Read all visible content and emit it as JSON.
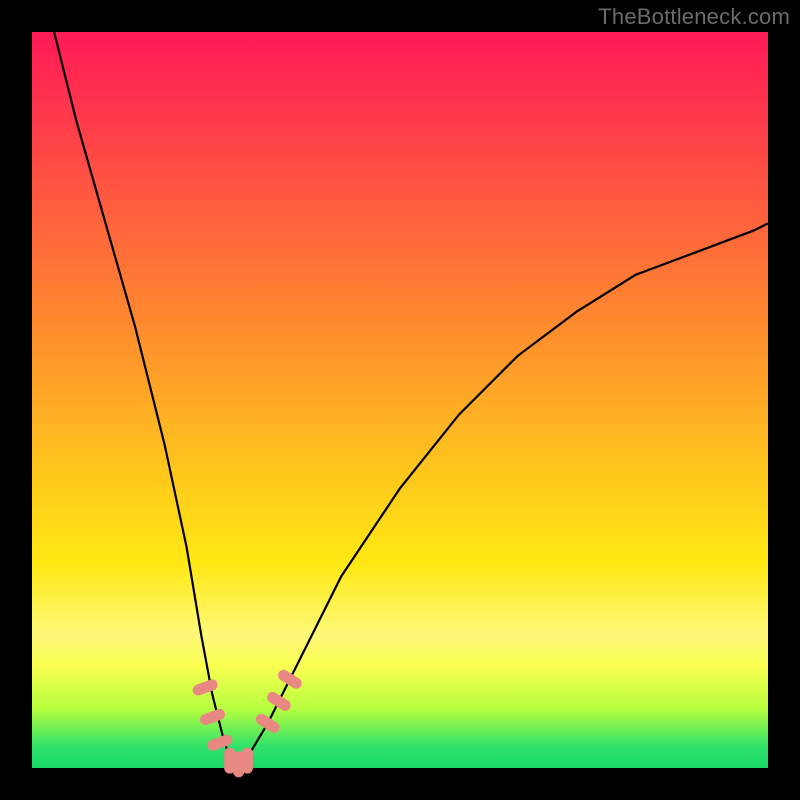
{
  "watermark": {
    "text": "TheBottleneck.com"
  },
  "colors": {
    "black": "#000000",
    "curve": "#000000",
    "marker": "#e98782",
    "gradient_top": "#ff1a55",
    "gradient_bottom": "#19d867"
  },
  "chart_data": {
    "type": "line",
    "title": "",
    "xlabel": "",
    "ylabel": "",
    "xlim": [
      0,
      100
    ],
    "ylim": [
      0,
      100
    ],
    "grid": false,
    "legend": false,
    "note": "V-shaped bottleneck curve. Background gradient encodes bottleneck severity: red (top) ≈ 100% mismatch, green (bottom) ≈ 0% mismatch. No axis ticks or numeric labels are rendered; values are approximate, read from pixel position relative to the plot area.",
    "series": [
      {
        "name": "bottleneck-curve",
        "x": [
          3,
          6,
          10,
          14,
          18,
          21,
          23,
          24.5,
          26,
          27,
          28,
          29,
          32,
          36,
          42,
          50,
          58,
          66,
          74,
          82,
          90,
          98,
          100
        ],
        "y": [
          100,
          88,
          74,
          60,
          44,
          30,
          18,
          10,
          4,
          1,
          0,
          1,
          6,
          14,
          26,
          38,
          48,
          56,
          62,
          67,
          70,
          73,
          74
        ]
      }
    ],
    "markers": [
      {
        "name": "left-band-1",
        "x": 23.5,
        "y": 11
      },
      {
        "name": "left-band-2",
        "x": 24.5,
        "y": 7
      },
      {
        "name": "left-band-3",
        "x": 25.5,
        "y": 3.5
      },
      {
        "name": "floor-1",
        "x": 26.8,
        "y": 1
      },
      {
        "name": "floor-2",
        "x": 28.0,
        "y": 0.5
      },
      {
        "name": "floor-3",
        "x": 29.2,
        "y": 1
      },
      {
        "name": "right-band-1",
        "x": 32.0,
        "y": 6
      },
      {
        "name": "right-band-2",
        "x": 33.5,
        "y": 9
      },
      {
        "name": "right-band-3",
        "x": 35.0,
        "y": 12
      }
    ]
  }
}
